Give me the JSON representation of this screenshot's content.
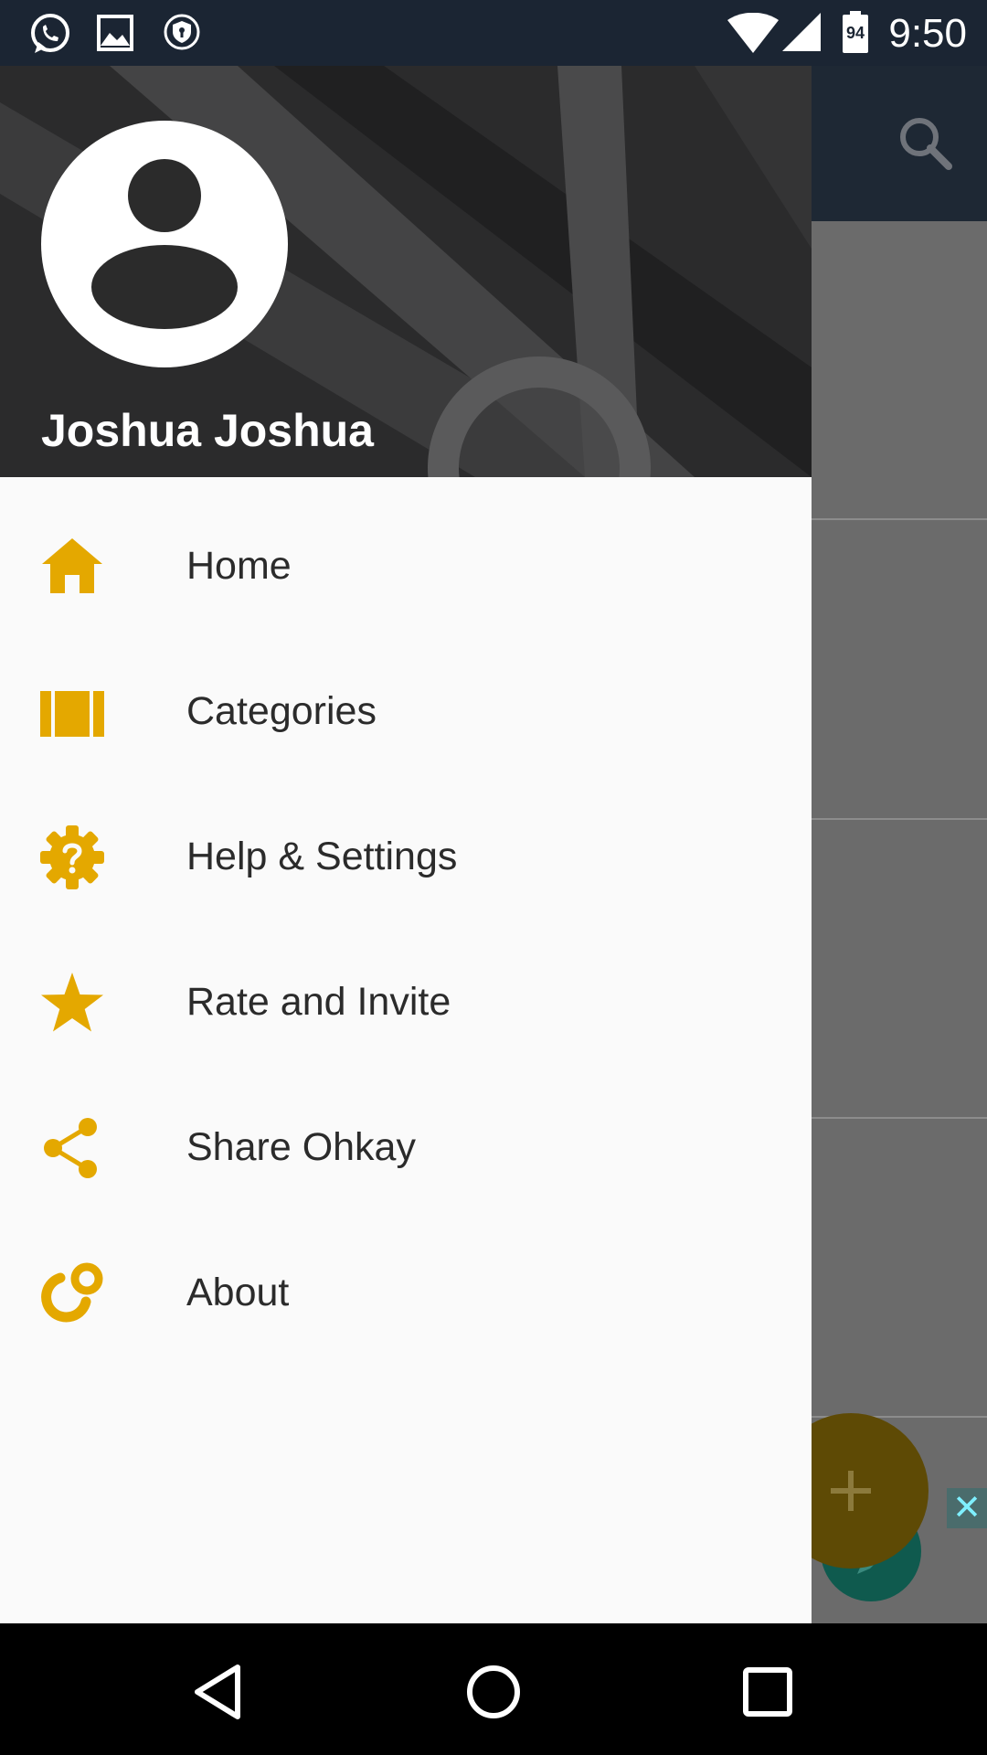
{
  "status_bar": {
    "time": "9:50",
    "battery_level": "94",
    "icons": [
      "whatsapp-icon",
      "gallery-icon",
      "vpn-shield-icon",
      "wifi-icon",
      "cell-signal-icon",
      "battery-icon"
    ]
  },
  "drawer": {
    "user_name": "Joshua Joshua",
    "accent_color": "#e4a800",
    "items": [
      {
        "label": "Home",
        "icon": "home-icon"
      },
      {
        "label": "Categories",
        "icon": "categories-icon"
      },
      {
        "label": "Help & Settings",
        "icon": "help-settings-icon"
      },
      {
        "label": "Rate and Invite",
        "icon": "star-icon"
      },
      {
        "label": "Share Ohkay",
        "icon": "share-icon"
      },
      {
        "label": "About",
        "icon": "about-icon"
      }
    ]
  },
  "app": {
    "toolbar_icon": "search-icon",
    "fab_icons": [
      "add-icon",
      "edit-icon"
    ],
    "ad_close_label": "✕"
  }
}
